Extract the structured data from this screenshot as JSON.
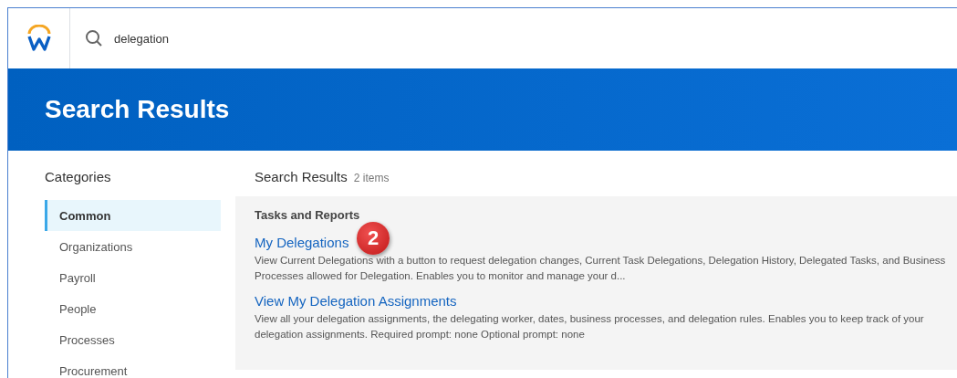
{
  "header": {
    "search": {
      "value": "delegation"
    }
  },
  "banner": {
    "title": "Search Results"
  },
  "categories": {
    "title": "Categories",
    "items": [
      {
        "label": "Common",
        "selected": true
      },
      {
        "label": "Organizations",
        "selected": false
      },
      {
        "label": "Payroll",
        "selected": false
      },
      {
        "label": "People",
        "selected": false
      },
      {
        "label": "Processes",
        "selected": false
      },
      {
        "label": "Procurement",
        "selected": false
      }
    ]
  },
  "results": {
    "title": "Search Results",
    "count": "2 items",
    "group": "Tasks and Reports",
    "callout": "2",
    "items": [
      {
        "title": "My Delegations",
        "description": "View Current Delegations with a button to request delegation changes, Current Task Delegations, Delegation History, Delegated Tasks, and Business Processes allowed for Delegation. Enables you to monitor and manage your d..."
      },
      {
        "title": "View My Delegation Assignments",
        "description": "View all your delegation assignments, the delegating worker, dates, business processes, and delegation rules. Enables you to keep track of your delegation assignments. Required prompt: none Optional prompt: none"
      }
    ]
  }
}
